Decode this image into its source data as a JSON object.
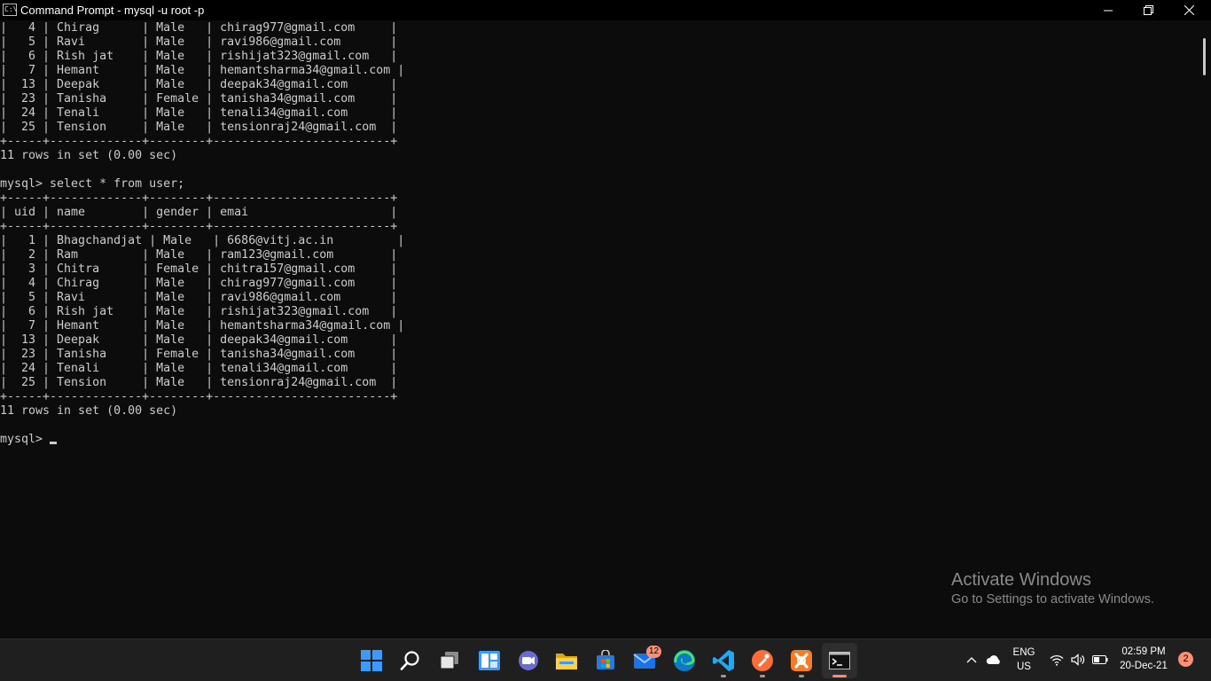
{
  "window": {
    "title": "Command Prompt - mysql  -u root -p",
    "icon_label": "C:\\"
  },
  "console": {
    "lines": [
      "|   4 | Chirag      | Male   | chirag977@gmail.com     |",
      "|   5 | Ravi        | Male   | ravi986@gmail.com       |",
      "|   6 | Rish jat    | Male   | rishijat323@gmail.com   |",
      "|   7 | Hemant      | Male   | hemantsharma34@gmail.com |",
      "|  13 | Deepak      | Male   | deepak34@gmail.com      |",
      "|  23 | Tanisha     | Female | tanisha34@gmail.com     |",
      "|  24 | Tenali      | Male   | tenali34@gmail.com      |",
      "|  25 | Tension     | Male   | tensionraj24@gmail.com  |",
      "+-----+-------------+--------+-------------------------+",
      "11 rows in set (0.00 sec)",
      "",
      "mysql> select * from user;",
      "+-----+-------------+--------+-------------------------+",
      "| uid | name        | gender | emai                    |",
      "+-----+-------------+--------+-------------------------+",
      "|   1 | Bhagchandjat | Male   | 6686@vitj.ac.in         |",
      "|   2 | Ram         | Male   | ram123@gmail.com        |",
      "|   3 | Chitra      | Female | chitra157@gmail.com     |",
      "|   4 | Chirag      | Male   | chirag977@gmail.com     |",
      "|   5 | Ravi        | Male   | ravi986@gmail.com       |",
      "|   6 | Rish jat    | Male   | rishijat323@gmail.com   |",
      "|   7 | Hemant      | Male   | hemantsharma34@gmail.com |",
      "|  13 | Deepak      | Male   | deepak34@gmail.com      |",
      "|  23 | Tanisha     | Female | tanisha34@gmail.com     |",
      "|  24 | Tenali      | Male   | tenali34@gmail.com      |",
      "|  25 | Tension     | Male   | tensionraj24@gmail.com  |",
      "+-----+-------------+--------+-------------------------+",
      "11 rows in set (0.00 sec)",
      "",
      "mysql> "
    ]
  },
  "watermark": {
    "title": "Activate Windows",
    "subtitle": "Go to Settings to activate Windows."
  },
  "taskbar": {
    "items": [
      {
        "name": "start-button",
        "icon": "windows-logo-icon"
      },
      {
        "name": "search-button",
        "icon": "search-icon"
      },
      {
        "name": "task-view-button",
        "icon": "task-view-icon"
      },
      {
        "name": "widgets-button",
        "icon": "widgets-icon"
      },
      {
        "name": "teams-chat-button",
        "icon": "chat-icon"
      },
      {
        "name": "file-explorer-button",
        "icon": "folder-icon"
      },
      {
        "name": "microsoft-store-button",
        "icon": "store-icon"
      },
      {
        "name": "mail-button",
        "icon": "mail-icon"
      },
      {
        "name": "edge-button",
        "icon": "edge-icon"
      },
      {
        "name": "vscode-button",
        "icon": "vscode-icon"
      },
      {
        "name": "postman-button",
        "icon": "postman-icon"
      },
      {
        "name": "xampp-button",
        "icon": "xampp-icon"
      },
      {
        "name": "command-prompt-button",
        "icon": "terminal-icon"
      }
    ],
    "mail_badge": "12",
    "colors": {
      "background": "#1f1f1f",
      "accent": "#ff8e72",
      "windows_blue": "#3a9bfc"
    }
  },
  "tray": {
    "language": "ENG",
    "region": "US",
    "time": "02:59 PM",
    "date": "20-Dec-21",
    "notifications": "2"
  }
}
